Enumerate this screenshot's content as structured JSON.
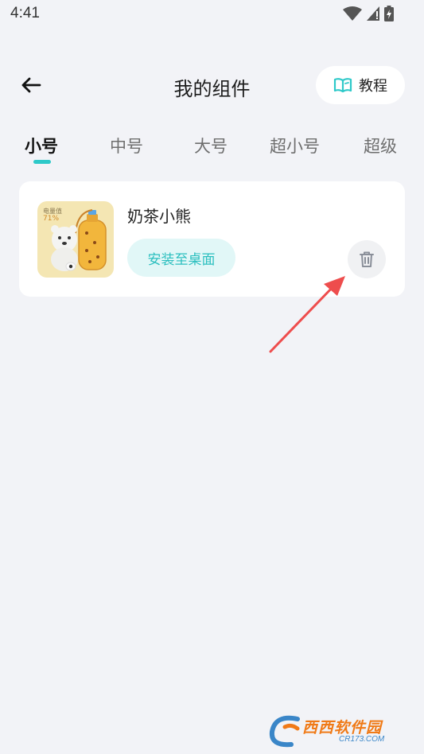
{
  "status_bar": {
    "time": "4:41",
    "icons": [
      "wifi-icon",
      "signal-icon",
      "battery-charging-icon"
    ]
  },
  "header": {
    "title": "我的组件",
    "back_icon": "arrow-left-icon",
    "tutorial_label": "教程",
    "tutorial_icon": "book-icon"
  },
  "tabs": [
    {
      "label": "小号",
      "active": true
    },
    {
      "label": "中号",
      "active": false
    },
    {
      "label": "大号",
      "active": false
    },
    {
      "label": "超小号",
      "active": false
    },
    {
      "label": "超级",
      "active": false
    }
  ],
  "widget": {
    "name": "奶茶小熊",
    "thumb_label": "电量值",
    "thumb_percent": "71%",
    "install_label": "安装至桌面",
    "delete_icon": "trash-icon"
  },
  "watermark": {
    "text_cn": "西西软件园",
    "text_en": "CR173.COM"
  },
  "colors": {
    "accent": "#2ec9c9",
    "install_bg": "#e1f7f7",
    "page_bg": "#f2f3f7",
    "arrow": "#ee4d4d"
  }
}
